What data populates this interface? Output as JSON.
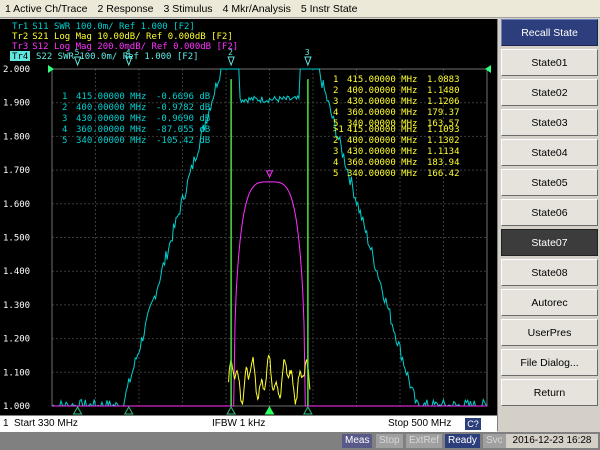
{
  "menu": [
    "1 Active Ch/Trace",
    "2 Response",
    "3 Stimulus",
    "4 Mkr/Analysis",
    "5 Instr State"
  ],
  "traces": [
    {
      "id": "Tr1",
      "text": "S11  SWR 100.0m/ Ref 1.000 [F2]",
      "color": "#00d0d0"
    },
    {
      "id": "Tr2",
      "text": "S21  Log Mag 10.00dB/ Ref 0.000dB [F2]",
      "color": "#ffff30"
    },
    {
      "id": "Tr3",
      "text": "S12  Log Mag 200.0mdB/ Ref 0.000dB [F2]",
      "color": "#ff30ff"
    },
    {
      "id": "Tr4",
      "text": "S22  SWR 100.0m/ Ref 1.000 [F2]",
      "color": "#60e8e0"
    }
  ],
  "y_ticks": [
    "2.000",
    "1.900",
    "1.800",
    "1.700",
    "1.600",
    "1.500",
    "1.400",
    "1.300",
    "1.200",
    "1.100",
    "1.000"
  ],
  "marker_table_left": [
    {
      "n": "1",
      "freq": "415.00000 MHz",
      "val": "-0.6696 dB"
    },
    {
      "n": "2",
      "freq": "400.00000 MHz",
      "val": "-0.9782 dB"
    },
    {
      "n": "3",
      "freq": "430.00000 MHz",
      "val": "-0.9690 dB"
    },
    {
      "n": "4",
      "freq": "360.00000 MHz",
      "val": "-87.055 dB"
    },
    {
      "n": "5",
      "freq": "340.00000 MHz",
      "val": "-105.42 dB"
    }
  ],
  "marker_table_right_a": [
    {
      "n": "1",
      "freq": "415.00000 MHz",
      "val": "1.0883"
    },
    {
      "n": "2",
      "freq": "400.00000 MHz",
      "val": "1.1480"
    },
    {
      "n": "3",
      "freq": "430.00000 MHz",
      "val": "1.1206"
    },
    {
      "n": "4",
      "freq": "360.00000 MHz",
      "val": "179.37"
    },
    {
      "n": "5",
      "freq": "340.00000 MHz",
      "val": "163.57"
    }
  ],
  "marker_table_right_b": [
    {
      "n": ">1",
      "freq": "415.00000 MHz",
      "val": "1.1093"
    },
    {
      "n": "2",
      "freq": "400.00000 MHz",
      "val": "1.1302"
    },
    {
      "n": "3",
      "freq": "430.00000 MHz",
      "val": "1.1134"
    },
    {
      "n": "4",
      "freq": "360.00000 MHz",
      "val": "183.94"
    },
    {
      "n": "5",
      "freq": "340.00000 MHz",
      "val": "166.42"
    }
  ],
  "top_markers": [
    "4",
    "5",
    "2",
    "3"
  ],
  "softkeys": {
    "title": "Recall State",
    "items": [
      "State01",
      "State02",
      "State03",
      "State04",
      "State05",
      "State06",
      "State07",
      "State08",
      "Autorec",
      "UserPres",
      "File Dialog...",
      "Return"
    ],
    "active": "State07"
  },
  "bottom": {
    "channel": "1",
    "start": "Start 330 MHz",
    "ifbw": "IFBW 1 kHz",
    "stop": "Stop 500 MHz",
    "ch_badge": "C?"
  },
  "status": {
    "meas": "Meas",
    "stop": "Stop",
    "extref": "ExtRef",
    "ready": "Ready",
    "svc": "Svc",
    "datetime": "2016-12-23 16:28"
  },
  "colors": {
    "s11": "#00d0d0",
    "s21": "#ffff30",
    "s12": "#ff30ff",
    "s22": "#60e8e0",
    "grid": "#3a3a3a",
    "tick_text": "#ffffff"
  }
}
